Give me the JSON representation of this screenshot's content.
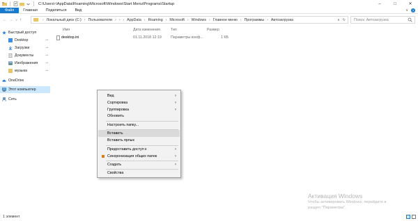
{
  "window": {
    "title": "C:\\Users\\-\\AppData\\Roaming\\Microsoft\\Windows\\Start Menu\\Programs\\Startup",
    "minimize": "–",
    "maximize": "□",
    "close": "✕"
  },
  "ribbon": {
    "tabs": [
      "Файл",
      "Главная",
      "Поделиться",
      "Вид"
    ]
  },
  "nav": {
    "back": "←",
    "forward": "→",
    "dropdown": "∨",
    "up": "↑"
  },
  "breadcrumb": [
    "Локальный диск (C:)",
    "Пользователи",
    "-",
    "AppData",
    "Roaming",
    "Microsoft",
    "Windows",
    "Главное меню",
    "Программы",
    "Автозагрузка"
  ],
  "search": {
    "placeholder": "Поиск: Автозагрузка"
  },
  "sidebar": {
    "items": [
      {
        "label": "Быстрый доступ",
        "icon": "star-icon",
        "pinned": false
      },
      {
        "label": "Desktop",
        "icon": "desktop-folder-icon",
        "pinned": true
      },
      {
        "label": "Загрузки",
        "icon": "download-icon",
        "pinned": true
      },
      {
        "label": "Документы",
        "icon": "documents-icon",
        "pinned": true
      },
      {
        "label": "Изображения",
        "icon": "pictures-icon",
        "pinned": true
      },
      {
        "label": "музыка",
        "icon": "folder-icon",
        "pinned": true
      },
      {
        "label": "OneDrive",
        "icon": "cloud-icon",
        "pinned": false
      },
      {
        "label": "Этот компьютер",
        "icon": "computer-icon",
        "pinned": false
      },
      {
        "label": "Сеть",
        "icon": "network-icon",
        "pinned": false
      }
    ],
    "selected": "Этот компьютер"
  },
  "content": {
    "columns": [
      "Имя",
      "Дата изменения",
      "Тип",
      "Размер"
    ],
    "rows": [
      {
        "name": "desktop.ini",
        "date": "01.11.2018 12:19",
        "type": "Параметры конф...",
        "size": "1 КБ"
      }
    ]
  },
  "context_menu": {
    "items": [
      {
        "label": "Вид",
        "submenu": true
      },
      {
        "label": "Сортировка",
        "submenu": true
      },
      {
        "label": "Группировка",
        "submenu": true
      },
      {
        "label": "Обновить",
        "submenu": false
      },
      {
        "label": "Настроить папку...",
        "submenu": false
      },
      {
        "label": "Вставить",
        "submenu": false,
        "highlighted": true
      },
      {
        "label": "Вставить ярлык",
        "submenu": false
      },
      {
        "label": "Предоставить доступ к",
        "submenu": true
      },
      {
        "label": "Синхронизация общих папок",
        "submenu": true
      },
      {
        "label": "Создать",
        "submenu": true
      },
      {
        "label": "Свойства",
        "submenu": false
      }
    ]
  },
  "watermark": {
    "title": "Активация Windows",
    "line1": "Чтобы активировать Windows, перейдите в",
    "line2": "раздел \"Параметры\"."
  },
  "status": {
    "count": "1 элемент"
  },
  "colors": {
    "accent": "#1979ca",
    "selection": "#cce8ff",
    "folder": "#e8c46a"
  }
}
